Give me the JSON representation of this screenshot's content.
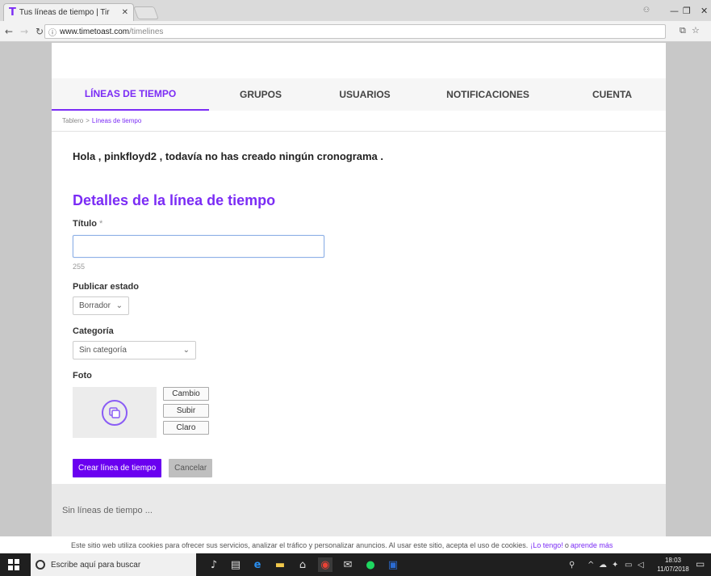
{
  "browser": {
    "tab_title": "Tus líneas de tiempo | Tir",
    "tab_favicon": "T",
    "url_host": "www.timetoast.com",
    "url_path": "/timelines"
  },
  "nav": {
    "items": [
      "LÍNEAS DE TIEMPO",
      "GRUPOS",
      "USUARIOS",
      "NOTIFICACIONES",
      "CUENTA"
    ],
    "active_index": 0
  },
  "breadcrumb": {
    "root": "Tablero",
    "separator": ">",
    "current": "Líneas de tiempo"
  },
  "greeting": "Hola , pinkfloyd2 , todavía no has creado ningún cronograma .",
  "form": {
    "heading": "Detalles de la línea de tiempo",
    "title_label": "Título",
    "title_required": "*",
    "title_value": "",
    "title_counter": "255",
    "status_label": "Publicar estado",
    "status_value": "Borrador",
    "category_label": "Categoría",
    "category_value": "Sin categoría",
    "photo_label": "Foto",
    "photo_buttons": [
      "Cambio",
      "Subir",
      "Claro"
    ],
    "create_button": "Crear línea de tiempo",
    "cancel_button": "Cancelar"
  },
  "empty_state": "Sin líneas de tiempo ...",
  "cookie_bar": {
    "text": "Este sitio web utiliza cookies para ofrecer sus servicios, analizar el tráfico y personalizar anuncios. Al usar este sitio, acepta el uso de cookies.",
    "accept_link": "¡Lo tengo!",
    "or": "o",
    "learn_link": "aprende más"
  },
  "taskbar": {
    "search_placeholder": "Escribe aquí para buscar",
    "time": "18:03",
    "date": "11/07/2018"
  },
  "colors": {
    "accent": "#7b2cf5",
    "primary_button": "#6a00f0"
  }
}
